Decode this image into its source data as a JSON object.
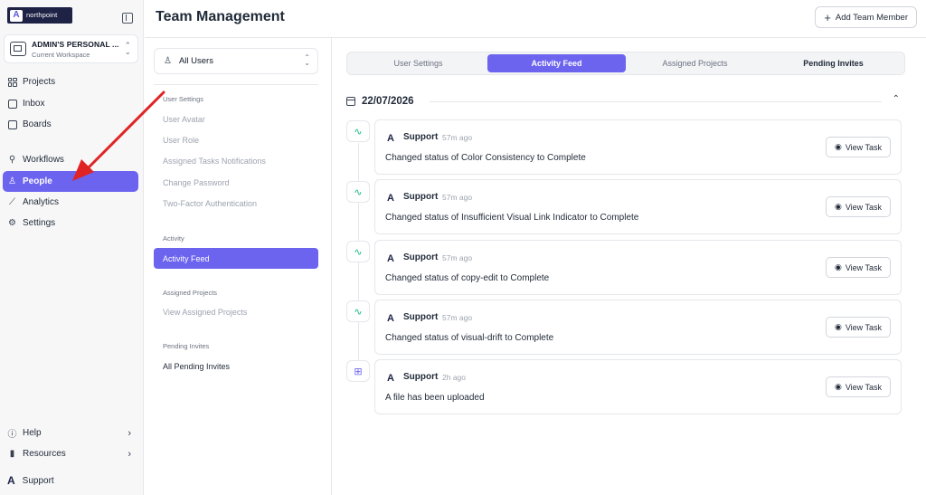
{
  "sidebar": {
    "brand": "northpoint",
    "workspace": {
      "name": "ADMIN'S PERSONAL ...",
      "subtitle": "Current Workspace"
    },
    "items": [
      {
        "label": "Projects",
        "icon": "grid-icon"
      },
      {
        "label": "Inbox",
        "icon": "inbox-icon"
      },
      {
        "label": "Boards",
        "icon": "board-icon"
      },
      {
        "label": "Workflows",
        "icon": "workflow-icon"
      },
      {
        "label": "People",
        "icon": "user-icon",
        "active": true
      },
      {
        "label": "Analytics",
        "icon": "chart-icon"
      },
      {
        "label": "Settings",
        "icon": "gear-icon"
      }
    ],
    "bottom": [
      {
        "label": "Help",
        "icon": "help-icon"
      },
      {
        "label": "Resources",
        "icon": "bar-chart-icon"
      }
    ],
    "user": "Support"
  },
  "header": {
    "title": "Team Management",
    "add_button": "Add Team Member"
  },
  "settings_panel": {
    "user_select": "All Users",
    "sections": [
      {
        "heading": "User Settings",
        "items": [
          "User Avatar",
          "User Role",
          "Assigned Tasks Notifications",
          "Change Password",
          "Two-Factor Authentication"
        ]
      },
      {
        "heading": "Activity",
        "items": [
          "Activity Feed"
        ]
      },
      {
        "heading": "Assigned Projects",
        "items": [
          "View Assigned Projects"
        ]
      },
      {
        "heading": "Pending Invites",
        "items": [
          "All Pending Invites"
        ]
      }
    ]
  },
  "tabs": [
    "User Settings",
    "Activity Feed",
    "Assigned Projects",
    "Pending Invites"
  ],
  "feed": {
    "date": "22/07/2026",
    "entries": [
      {
        "user": "Support",
        "time": "57m ago",
        "message": "Changed status of Color Consistency to Complete",
        "action": "View Task",
        "icon": "activity-icon"
      },
      {
        "user": "Support",
        "time": "57m ago",
        "message": "Changed status of Insufficient Visual Link Indicator to Complete",
        "action": "View Task",
        "icon": "activity-icon"
      },
      {
        "user": "Support",
        "time": "57m ago",
        "message": "Changed status of copy-edit to Complete",
        "action": "View Task",
        "icon": "activity-icon"
      },
      {
        "user": "Support",
        "time": "57m ago",
        "message": "Changed status of visual-drift to Complete",
        "action": "View Task",
        "icon": "activity-icon"
      },
      {
        "user": "Support",
        "time": "2h ago",
        "message": "A file has been uploaded",
        "action": "View Task",
        "icon": "upload-icon"
      }
    ]
  },
  "colors": {
    "accent": "#6c63ef",
    "brand_dark": "#1e2245",
    "activity_green": "#10b981",
    "annotation_red": "#e02424"
  }
}
